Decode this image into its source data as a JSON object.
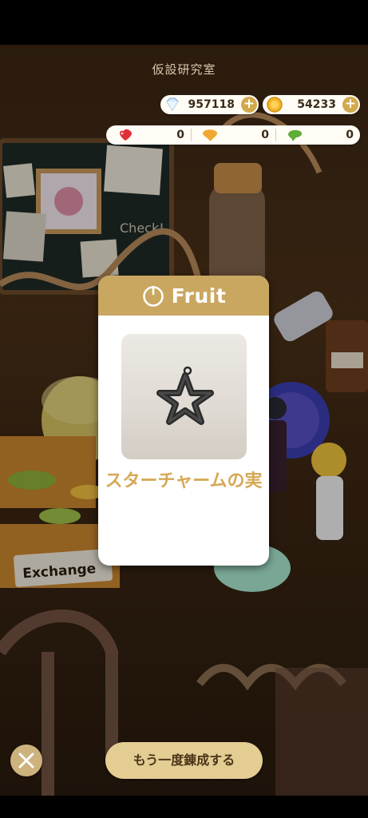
{
  "header": {
    "title": "仮設研究室"
  },
  "currency": {
    "diamond": {
      "value": "957118",
      "icon": "diamond-icon",
      "plus": "+"
    },
    "coin": {
      "value": "54233",
      "icon": "coin-icon",
      "plus": "+"
    }
  },
  "seeds": [
    {
      "icon": "red-heart-seed-icon",
      "value": "0",
      "color": "#e0303a"
    },
    {
      "icon": "yellow-seed-icon",
      "value": "0",
      "color": "#f0a830"
    },
    {
      "icon": "green-seed-icon",
      "value": "0",
      "color": "#5fae3a"
    }
  ],
  "dialog": {
    "header_label": "Fruit",
    "header_icon": "timer-icon",
    "item_icon": "star-charm-icon",
    "item_name": "スターチャームの実"
  },
  "actions": {
    "close_icon": "close-icon",
    "retry_label": "もう一度錬成する"
  },
  "scene": {
    "exchange_sign": "Exchange",
    "check_note": "Check!"
  },
  "colors": {
    "accent_gold": "#c9a760",
    "item_name": "#d6a855",
    "button_fill": "#e4cd93"
  }
}
